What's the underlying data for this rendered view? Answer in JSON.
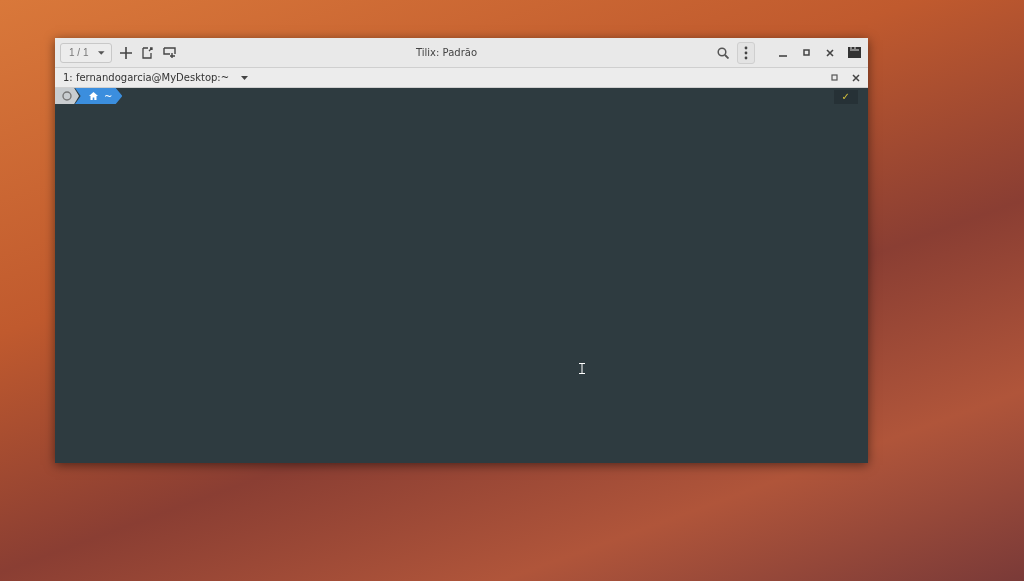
{
  "window": {
    "title": "Tilix: Padrão"
  },
  "session_selector": {
    "value": "1 / 1"
  },
  "terminal_tab": {
    "title": "1: fernandogarcia@MyDesktop:~"
  },
  "prompt": {
    "path": "~",
    "status": "✓"
  }
}
